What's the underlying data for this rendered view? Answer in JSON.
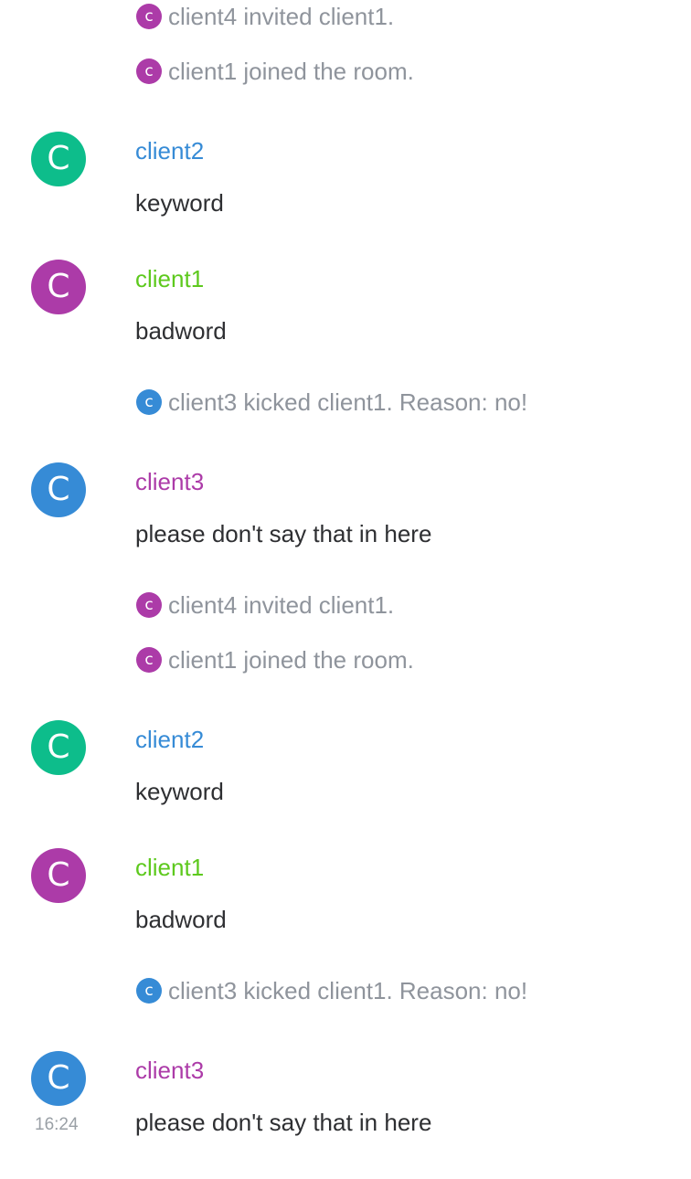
{
  "colors": {
    "purple": "#ac3ba8",
    "green": "#0dbd8b",
    "blue": "#368bd6",
    "name_green": "#5dc91d",
    "name_blue": "#368bd6",
    "name_purple": "#ac3ba8",
    "event_text": "#8f949c",
    "body_text": "#2e2f32"
  },
  "timeline": [
    {
      "kind": "event",
      "icon_letter": "c",
      "icon_color": "purple",
      "text": "client4 invited client1."
    },
    {
      "kind": "event",
      "icon_letter": "c",
      "icon_color": "purple",
      "text": "client1 joined the room."
    },
    {
      "kind": "message",
      "avatar_letter": "C",
      "avatar_color": "green",
      "sender": "client2",
      "sender_color": "name_blue",
      "body": "keyword"
    },
    {
      "kind": "message",
      "avatar_letter": "C",
      "avatar_color": "purple",
      "sender": "client1",
      "sender_color": "name_green",
      "body": "badword"
    },
    {
      "kind": "event",
      "icon_letter": "c",
      "icon_color": "blue",
      "text": "client3 kicked client1. Reason: no!"
    },
    {
      "kind": "message",
      "avatar_letter": "C",
      "avatar_color": "blue",
      "sender": "client3",
      "sender_color": "name_purple",
      "body": "please don't say that in here"
    },
    {
      "kind": "event",
      "icon_letter": "c",
      "icon_color": "purple",
      "text": "client4 invited client1."
    },
    {
      "kind": "event",
      "icon_letter": "c",
      "icon_color": "purple",
      "text": "client1 joined the room."
    },
    {
      "kind": "message",
      "avatar_letter": "C",
      "avatar_color": "green",
      "sender": "client2",
      "sender_color": "name_blue",
      "body": "keyword"
    },
    {
      "kind": "message",
      "avatar_letter": "C",
      "avatar_color": "purple",
      "sender": "client1",
      "sender_color": "name_green",
      "body": "badword"
    },
    {
      "kind": "event",
      "icon_letter": "c",
      "icon_color": "blue",
      "text": "client3 kicked client1. Reason: no!"
    },
    {
      "kind": "message",
      "avatar_letter": "C",
      "avatar_color": "blue",
      "sender": "client3",
      "sender_color": "name_purple",
      "body": "please don't say that in here",
      "timestamp": "16:24"
    }
  ]
}
